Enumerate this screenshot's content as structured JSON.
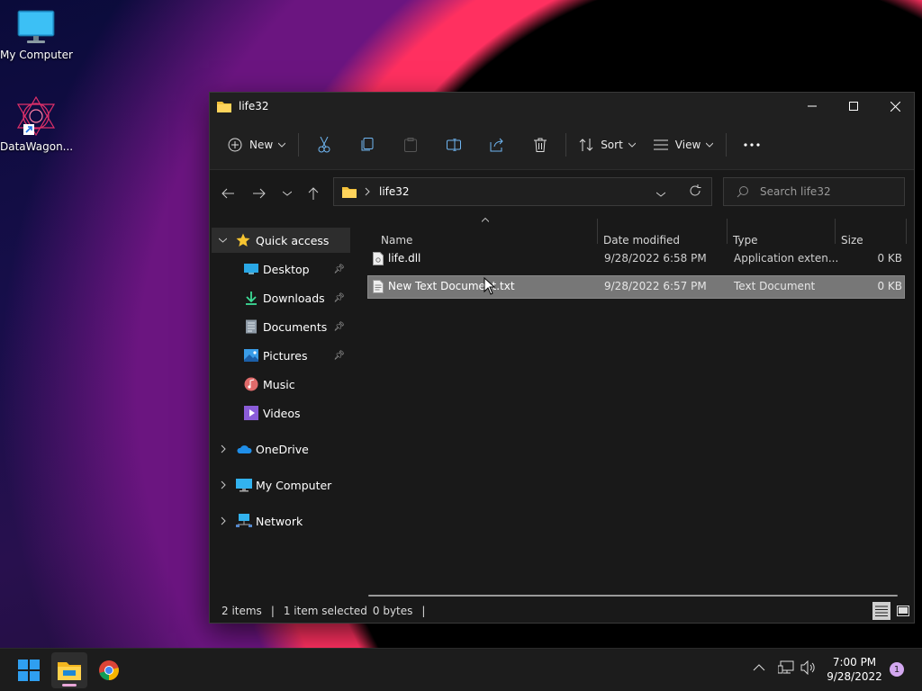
{
  "desktop": {
    "icons": [
      {
        "label": "My Computer",
        "icon": "monitor-icon"
      },
      {
        "label": "DataWagon...",
        "icon": "app-shortcut-icon"
      }
    ]
  },
  "window": {
    "title": "life32",
    "toolbar": {
      "new_label": "New",
      "sort_label": "Sort",
      "view_label": "View",
      "icons": [
        "plus-circle-icon",
        "cut-icon",
        "copy-icon",
        "paste-icon",
        "rename-icon",
        "share-icon",
        "delete-icon",
        "sort-icon",
        "view-icon",
        "more-icon"
      ]
    },
    "address": {
      "crumb": "life32"
    },
    "search": {
      "placeholder": "Search life32"
    },
    "sidebar": {
      "quick_access": "Quick access",
      "items": [
        {
          "label": "Desktop",
          "pinned": true
        },
        {
          "label": "Downloads",
          "pinned": true
        },
        {
          "label": "Documents",
          "pinned": true
        },
        {
          "label": "Pictures",
          "pinned": true
        },
        {
          "label": "Music",
          "pinned": false
        },
        {
          "label": "Videos",
          "pinned": false
        }
      ],
      "roots": [
        "OneDrive",
        "My Computer",
        "Network"
      ]
    },
    "columns": [
      "Name",
      "Date modified",
      "Type",
      "Size"
    ],
    "files": [
      {
        "name": "life.dll",
        "date": "9/28/2022 6:58 PM",
        "type": "Application exten...",
        "size": "0 KB",
        "selected": false
      },
      {
        "name": "New Text Document.txt",
        "date": "9/28/2022 6:57 PM",
        "type": "Text Document",
        "size": "0 KB",
        "selected": true
      }
    ],
    "status": {
      "items": "2 items",
      "selected": "1 item selected",
      "bytes": "0 bytes"
    }
  },
  "taskbar": {
    "time": "7:00 PM",
    "date": "9/28/2022",
    "notification_count": "1",
    "apps": [
      "start-icon",
      "file-explorer-icon",
      "chrome-icon"
    ]
  }
}
